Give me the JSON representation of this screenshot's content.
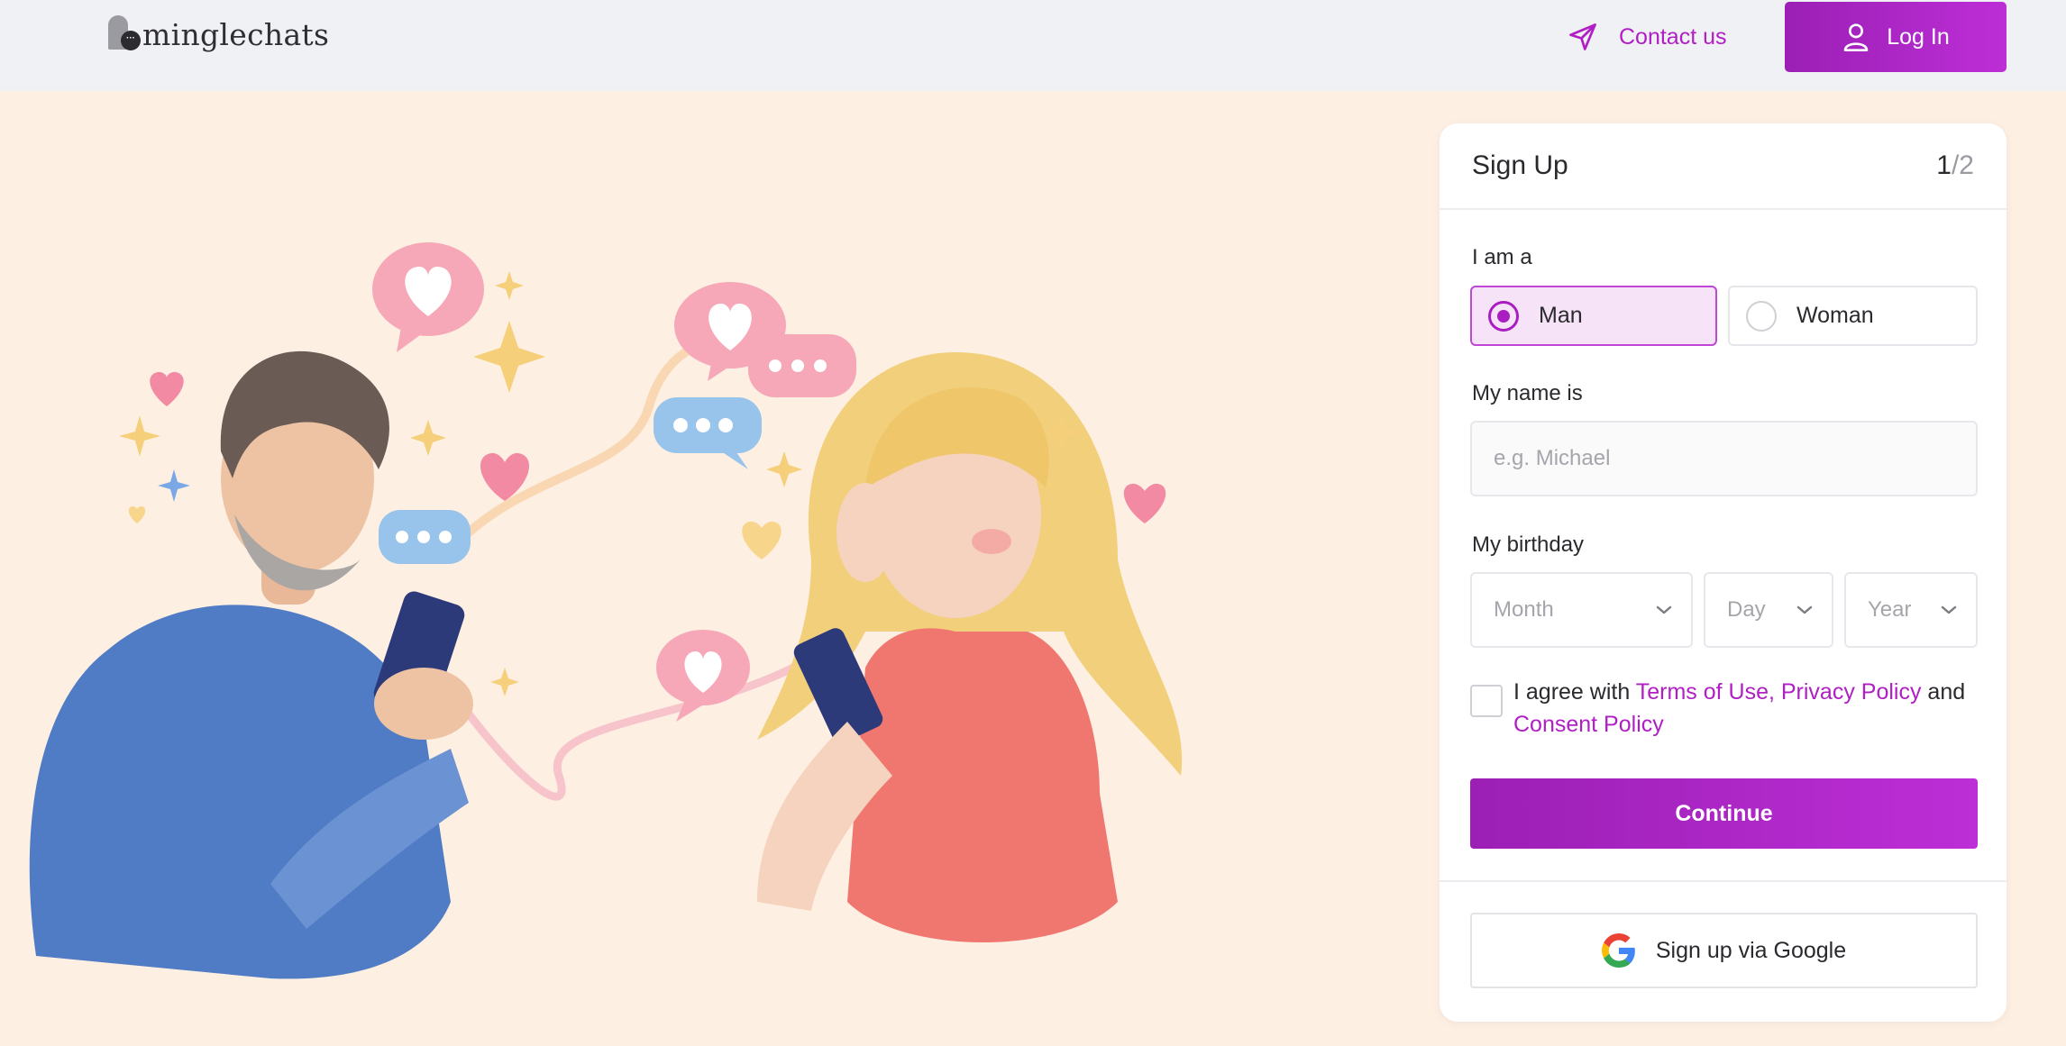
{
  "header": {
    "logo_text": "minglechats",
    "contact_label": "Contact us",
    "login_label": "Log In"
  },
  "signup": {
    "title": "Sign Up",
    "step_current": "1",
    "step_total": "/2",
    "gender_label": "I am a",
    "gender_options": [
      {
        "label": "Man",
        "selected": true
      },
      {
        "label": "Woman",
        "selected": false
      }
    ],
    "name_label": "My name is",
    "name_placeholder": "e.g. Michael",
    "name_value": "",
    "birthday_label": "My birthday",
    "month_placeholder": "Month",
    "day_placeholder": "Day",
    "year_placeholder": "Year",
    "agree_prefix": "I agree with ",
    "terms_link": "Terms of Use, Privacy Policy",
    "agree_and": " and",
    "consent_link": "Consent Policy",
    "agree_checked": false,
    "continue_label": "Continue",
    "google_label": "Sign up via Google"
  },
  "colors": {
    "accent": "#a81ec0",
    "header_bg": "#f0f1f5",
    "page_bg": "#fdefe2",
    "man_shirt": "#4f7cc4",
    "woman_top": "#f0776f",
    "woman_hair": "#f2cf7a",
    "bubble_pink": "#f7a8b8",
    "bubble_blue": "#98c3ea"
  },
  "illustration": {
    "subject": "man and woman texting on phones with heart and chat bubbles",
    "icons": [
      "heart-bubble-icon",
      "typing-bubble-icon",
      "sparkle-icon",
      "heart-icon"
    ]
  }
}
